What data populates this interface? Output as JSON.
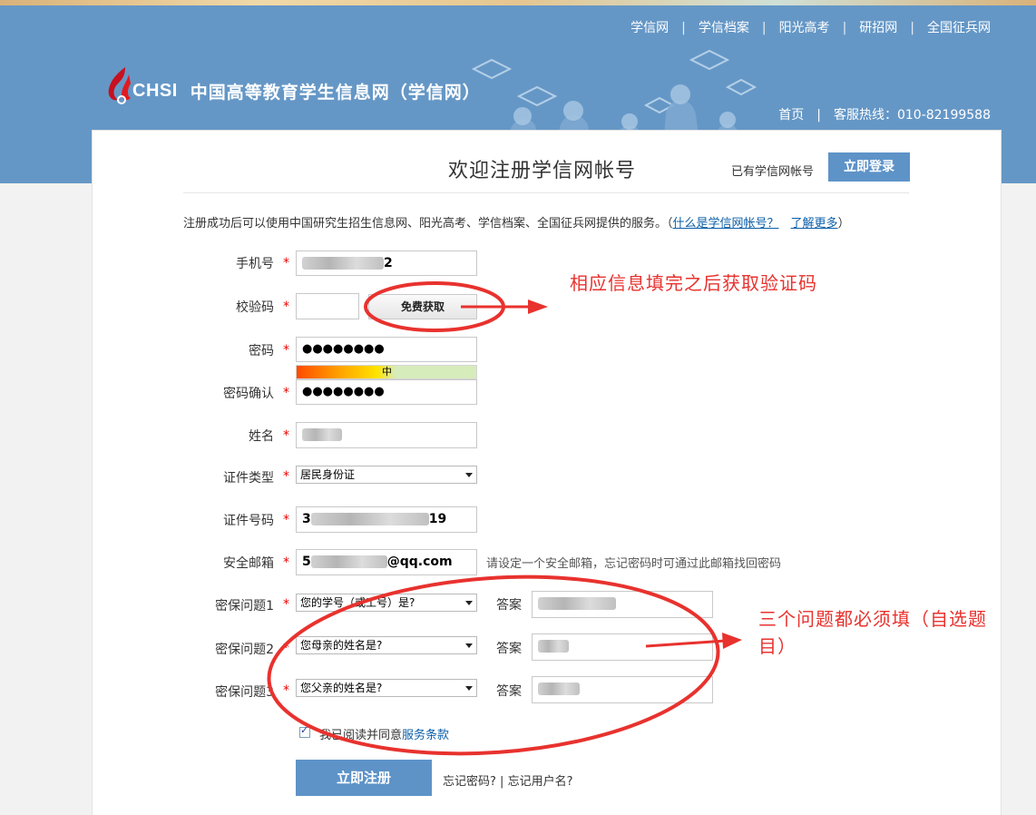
{
  "top_nav": [
    "学信网",
    "学信档案",
    "阳光高考",
    "研招网",
    "全国征兵网"
  ],
  "separator": "|",
  "logo": {
    "mark_text": "CHSI",
    "title": "中国高等教育学生信息网（学信网）"
  },
  "sub_nav": {
    "home": "首页",
    "hotline": "客服热线：010-82199588"
  },
  "page": {
    "title": "欢迎注册学信网帐号",
    "has_account": "已有学信网帐号",
    "login_button": "立即登录",
    "intro_text": "注册成功后可以使用中国研究生招生信息网、阳光高考、学信档案、全国征兵网提供的服务。（",
    "intro_link1": "什么是学信网帐号？",
    "intro_link2": "了解更多",
    "intro_close": "）"
  },
  "form": {
    "required_mark": "*",
    "phone": {
      "label": "手机号",
      "value_suffix": "2"
    },
    "code": {
      "label": "校验码",
      "button": "免费获取"
    },
    "password": {
      "label": "密码",
      "value": "●●●●●●●●",
      "strength": "中"
    },
    "password_confirm": {
      "label": "密码确认",
      "value": "●●●●●●●●"
    },
    "name": {
      "label": "姓名"
    },
    "id_type": {
      "label": "证件类型",
      "value": "居民身份证"
    },
    "id_number": {
      "label": "证件号码",
      "value_prefix": "3",
      "value_suffix": "19"
    },
    "email": {
      "label": "安全邮箱",
      "value_prefix": "5",
      "value_suffix": "@qq.com",
      "hint": "请设定一个安全邮箱，忘记密码时可通过此邮箱找回密码"
    },
    "answer_label": "答案",
    "questions": [
      {
        "label": "密保问题1",
        "value": "您的学号（或工号）是?"
      },
      {
        "label": "密保问题2",
        "value": "您母亲的姓名是?"
      },
      {
        "label": "密保问题3",
        "value": "您父亲的姓名是?"
      }
    ],
    "agree_text": "我已阅读并同意",
    "agree_link": "服务条款",
    "register_button": "立即注册",
    "forgot_password": "忘记密码?",
    "forgot_sep": " | ",
    "forgot_username": "忘记用户名?"
  },
  "annotations": {
    "note1": "相应信息填完之后获取验证码",
    "note2_line1": "三个问题都必须填（自选题",
    "note2_line2": "目）"
  },
  "colors": {
    "header_blue": "#6597c6",
    "button_blue": "#5e93c8",
    "annotation_red": "#e8322e",
    "link_blue": "#0b5ea8"
  }
}
